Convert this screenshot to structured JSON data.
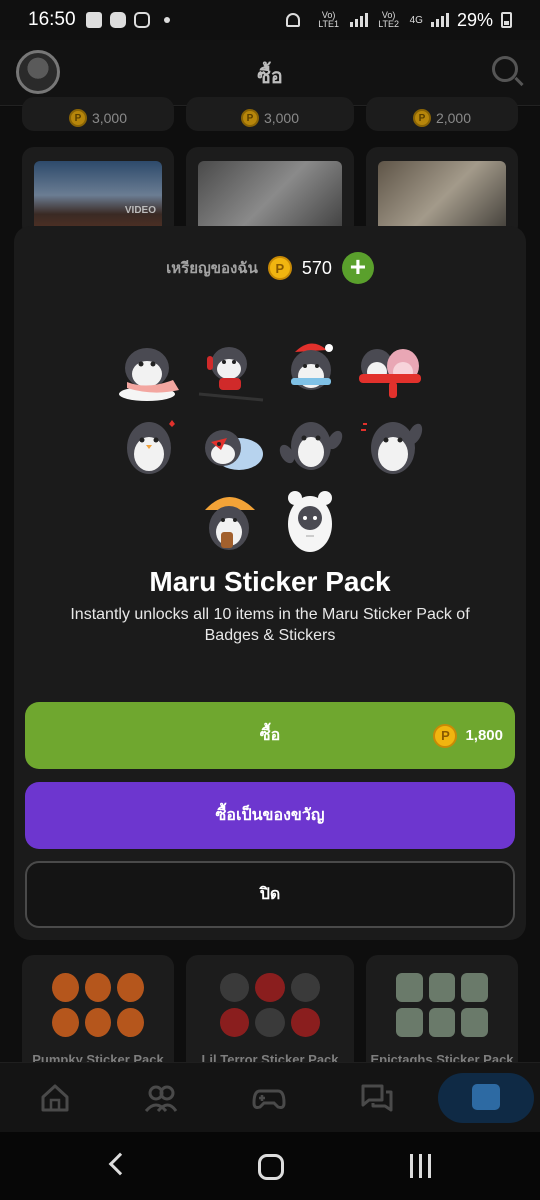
{
  "status_bar": {
    "time": "16:50",
    "net1": "Vo) LTE1",
    "net2": "Vo) LTE2",
    "net_type": "4G",
    "battery": "29%"
  },
  "header": {
    "title": "ซื้อ"
  },
  "background": {
    "top_prices": [
      "3,000",
      "3,000",
      "2,000"
    ],
    "video_tag": "VIDEO",
    "sticker_cards": [
      "Pumpky Sticker Pack",
      "Lil Terror Sticker Pack",
      "Epictaghs Sticker Pack"
    ]
  },
  "modal": {
    "coins_label": "เหรียญของฉัน",
    "coins_value": "570",
    "coin_icon_glyph": "P",
    "add_coin_glyph": "+",
    "pack_title": "Maru Sticker Pack",
    "pack_description": "Instantly unlocks all 10 items in the Maru Sticker Pack of Badges & Stickers",
    "buy_label": "ซื้อ",
    "buy_price": "1,800",
    "gift_label": "ซื้อเป็นของขวัญ",
    "close_label": "ปิด"
  },
  "colors": {
    "buy": "#6fa72f",
    "gift": "#6d36cf",
    "coin": "#f1b510",
    "modal_bg": "#1b1b1b"
  },
  "icons": {
    "nav": [
      "home-icon",
      "friends-icon",
      "gamepad-icon",
      "chat-icon",
      "store-icon"
    ]
  }
}
